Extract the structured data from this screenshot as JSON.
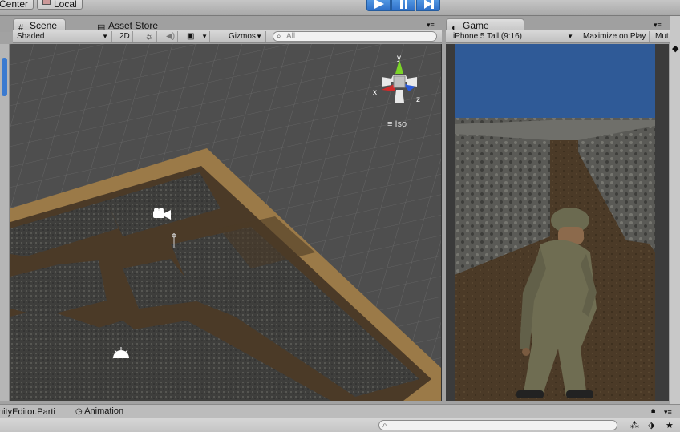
{
  "toolbar": {
    "pivot_label": "Center",
    "space_label": "Local",
    "play_icon": "play-icon",
    "pause_icon": "pause-icon",
    "step_icon": "step-icon",
    "accent": "#2e6fc8"
  },
  "scene_panel": {
    "tabs": [
      {
        "label": "Scene",
        "icon": "grid-icon"
      },
      {
        "label": "Asset Store",
        "icon": "store-icon"
      }
    ],
    "shading_mode": "Shaded",
    "mode_2d": "2D",
    "gizmos_label": "Gizmos",
    "search_placeholder": "All",
    "gizmo": {
      "x_label": "x",
      "y_label": "y",
      "z_label": "z",
      "projection": "Iso"
    }
  },
  "game_panel": {
    "tab_label": "Game",
    "tab_icon": "pacman-icon",
    "resolution": "iPhone 5 Tall (9:16)",
    "maximize_label": "Maximize on Play",
    "mute_label": "Mut"
  },
  "bottom": {
    "tabs": [
      {
        "label": "nityEditor.Parti"
      },
      {
        "label": "Animation",
        "icon": "clock-icon"
      }
    ]
  },
  "colors": {
    "sky": "#2f5a97",
    "wall": "#6b6b66",
    "floor": "#4b3a27",
    "border_sand": "#9b7a48"
  }
}
